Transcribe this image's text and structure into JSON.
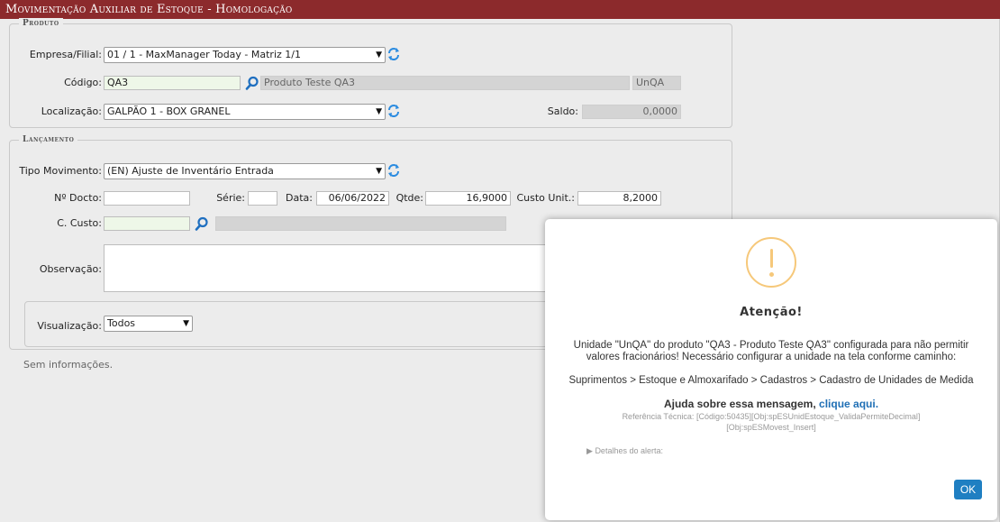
{
  "window": {
    "title": "Movimentação Auxiliar de Estoque  - Homologação"
  },
  "produto": {
    "legend": "Produto",
    "empresa_label": "Empresa/Filial:",
    "empresa_value": "01 / 1 - MaxManager Today - Matriz 1/1",
    "codigo_label": "Código:",
    "codigo_value": "QA3",
    "descricao_value": "Produto Teste QA3",
    "unidade_value": "UnQA",
    "localizacao_label": "Localização:",
    "localizacao_value": "GALPÃO 1 - BOX GRANEL",
    "saldo_label": "Saldo:",
    "saldo_value": "0,0000"
  },
  "lancamento": {
    "legend": "Lançamento",
    "tipo_label": "Tipo Movimento:",
    "tipo_value": "(EN) Ajuste de Inventário Entrada",
    "docto_label": "Nº Docto:",
    "docto_value": "",
    "serie_label": "Série:",
    "serie_value": "",
    "data_label": "Data:",
    "data_value": "06/06/2022",
    "qtde_label": "Qtde:",
    "qtde_value": "16,9000",
    "custo_unit_label": "Custo Unit.:",
    "custo_unit_value": "8,2000",
    "ccusto_label": "C. Custo:",
    "ccusto_value": "",
    "observacao_label": "Observação:"
  },
  "visualizacao": {
    "label": "Visualização:",
    "value": "Todos"
  },
  "status_text": "Sem informações.",
  "alert": {
    "title": "Atenção!",
    "message": "Unidade \"UnQA\" do produto \"QA3 - Produto Teste QA3\" configurada para não permitir valores fracionários! Necessário configurar a unidade na tela conforme caminho:",
    "path": "Suprimentos > Estoque e Almoxarifado > Cadastros > Cadastro de Unidades de Medida",
    "help_text": "Ajuda sobre essa mensagem,",
    "help_link": "clique aqui.",
    "reference": "Referência Técnica: [Código:50435][Obj:spESUnidEstoque_ValidaPermiteDecimal] [Obj:spESMovest_Insert]",
    "details_label": "Detalhes do alerta:",
    "ok_label": "OK"
  },
  "colors": {
    "titlebar": "#8c2a2c",
    "warning": "#f6c87a",
    "ok_button": "#1f7fc2",
    "link": "#1f6fb5"
  },
  "icons": {
    "refresh": "refresh-icon",
    "search": "search-icon",
    "chevron": "chevron-down-icon",
    "warning": "warning-icon"
  }
}
